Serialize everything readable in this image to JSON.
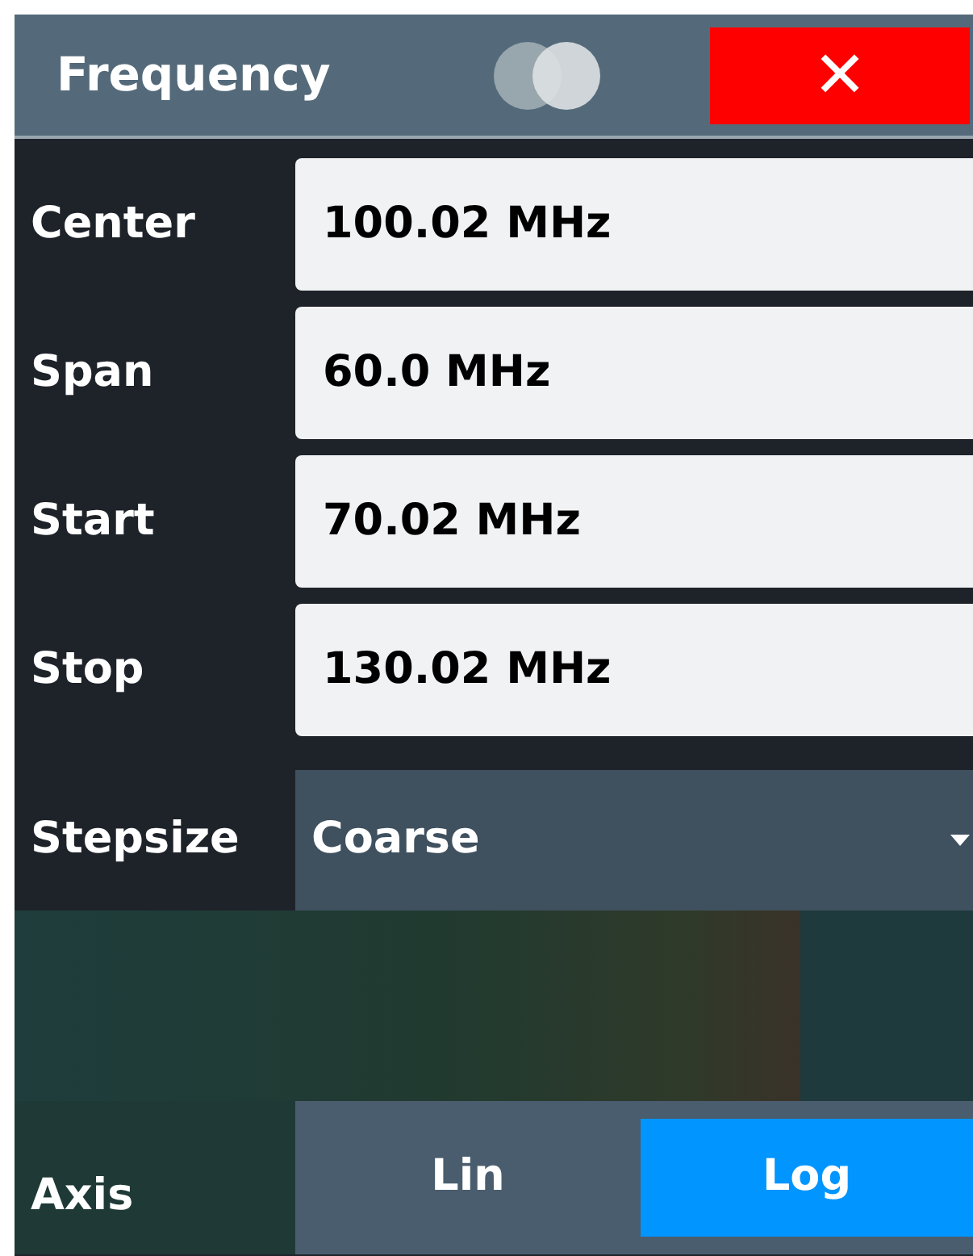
{
  "header": {
    "title": "Frequency",
    "close_label": "✕"
  },
  "fields": [
    {
      "label": "Center",
      "value": "100.02 MHz"
    },
    {
      "label": "Span",
      "value": "60.0 MHz"
    },
    {
      "label": "Start",
      "value": "70.02 MHz"
    },
    {
      "label": "Stop",
      "value": "130.02 MHz"
    }
  ],
  "stepsize": {
    "label": "Stepsize",
    "value": "Coarse"
  },
  "axis": {
    "label": "Axis",
    "options": [
      {
        "label": "Lin",
        "selected": false
      },
      {
        "label": "Log",
        "selected": true
      }
    ]
  }
}
